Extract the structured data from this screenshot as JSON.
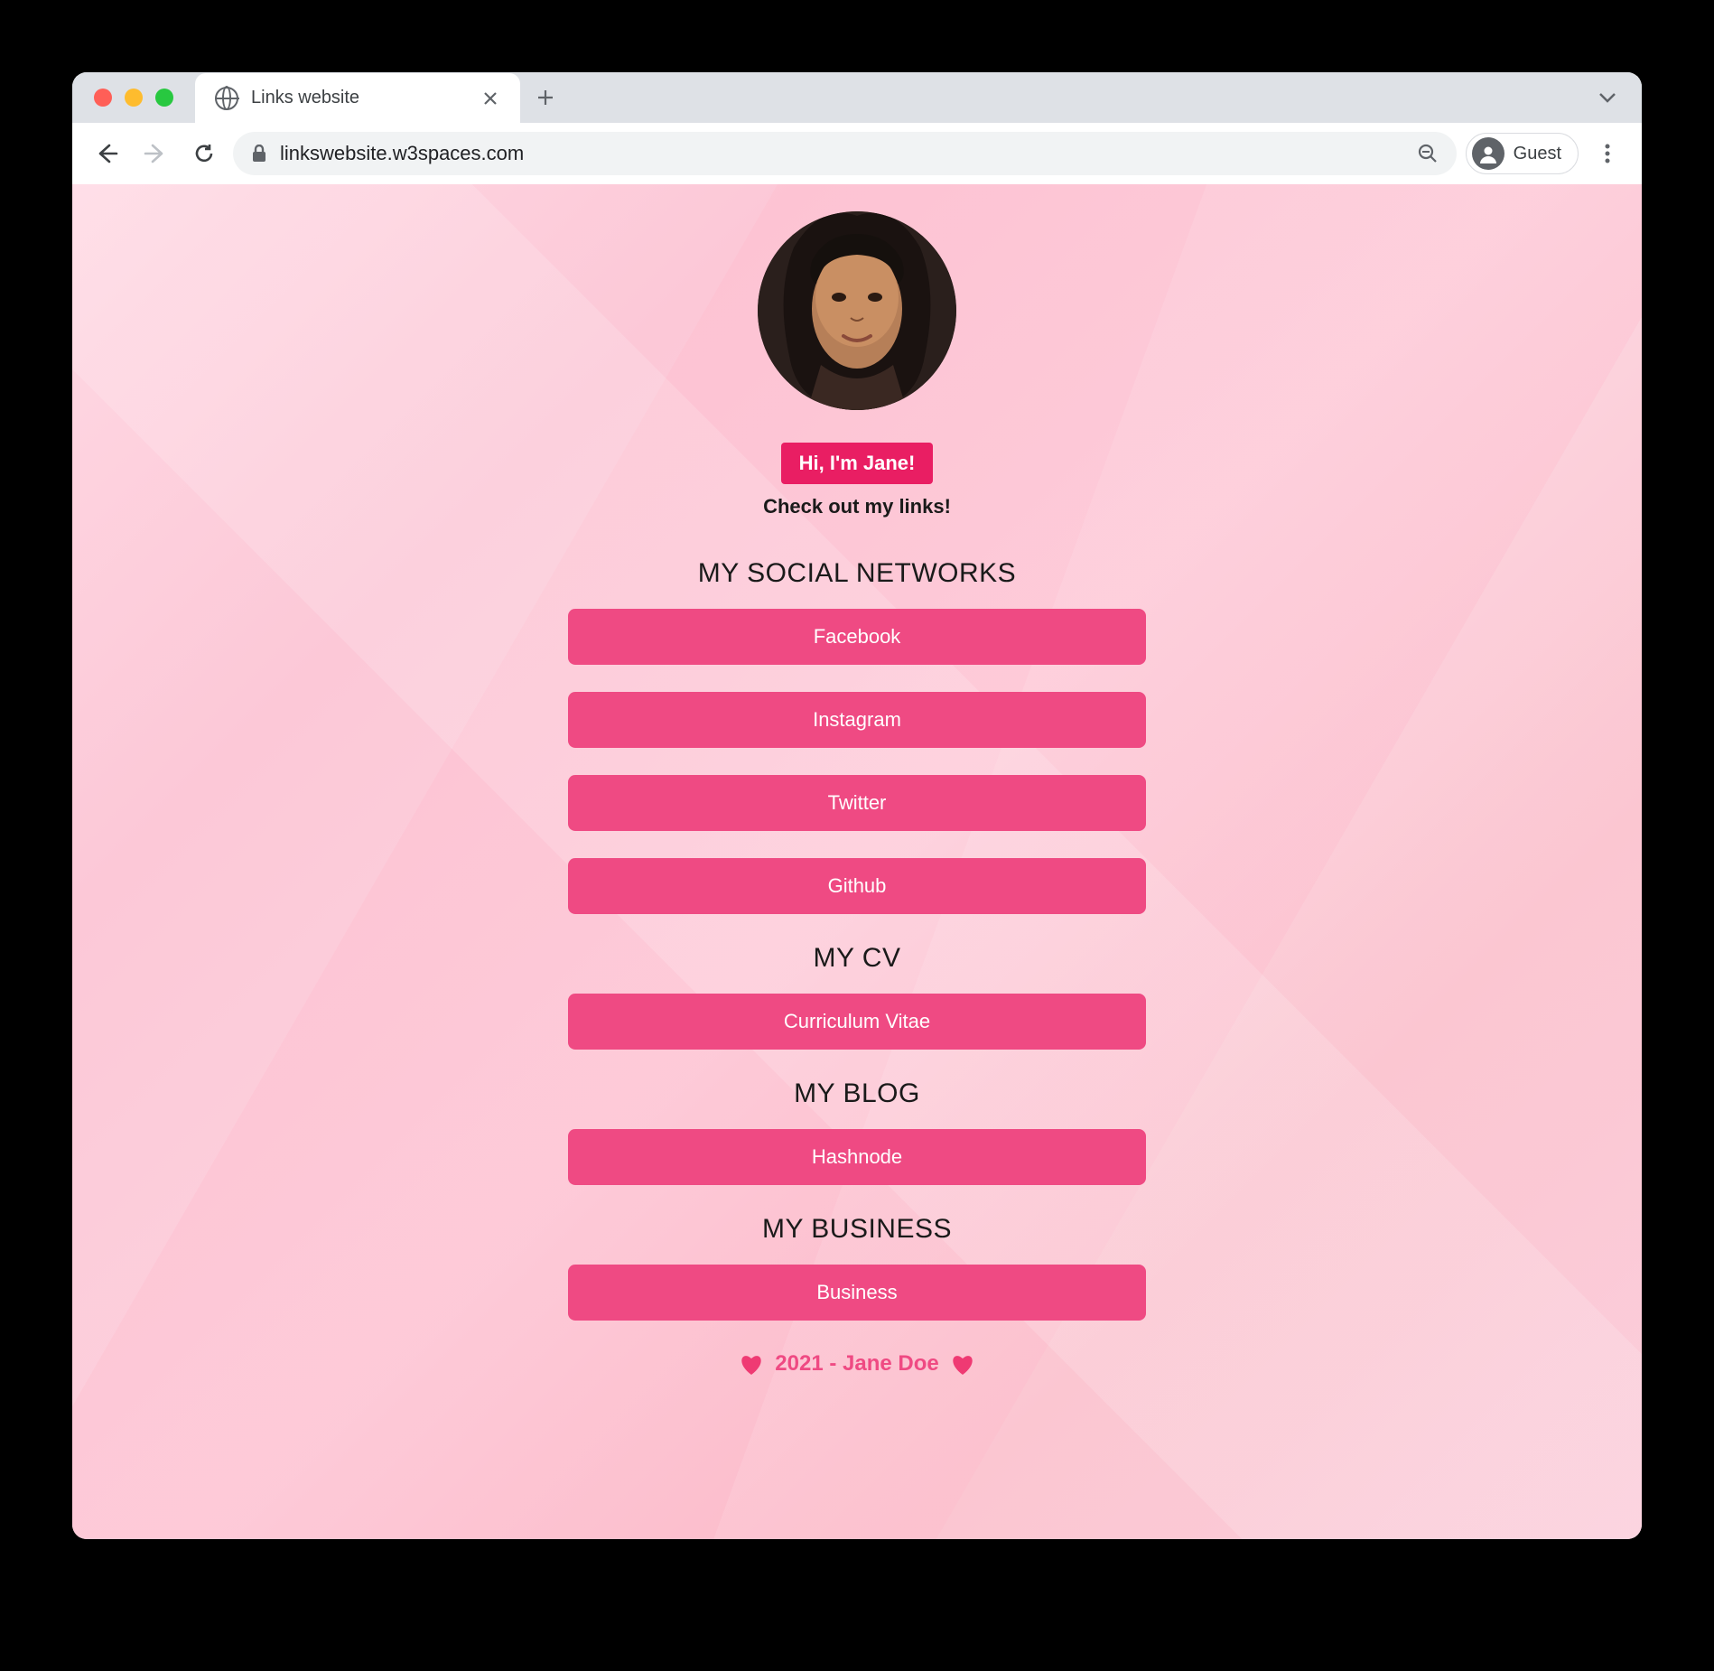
{
  "browser": {
    "tab_title": "Links website",
    "url": "linkswebsite.w3spaces.com",
    "guest_label": "Guest"
  },
  "profile": {
    "greeting": "Hi, I'm Jane!",
    "subtitle": "Check out my links!"
  },
  "sections": {
    "social": {
      "title": "MY SOCIAL NETWORKS",
      "links": [
        "Facebook",
        "Instagram",
        "Twitter",
        "Github"
      ]
    },
    "cv": {
      "title": "MY CV",
      "links": [
        "Curriculum Vitae"
      ]
    },
    "blog": {
      "title": "MY BLOG",
      "links": [
        "Hashnode"
      ]
    },
    "business": {
      "title": "MY BUSINESS",
      "links": [
        "Business"
      ]
    }
  },
  "footer": {
    "text": "2021 - Jane Doe"
  }
}
